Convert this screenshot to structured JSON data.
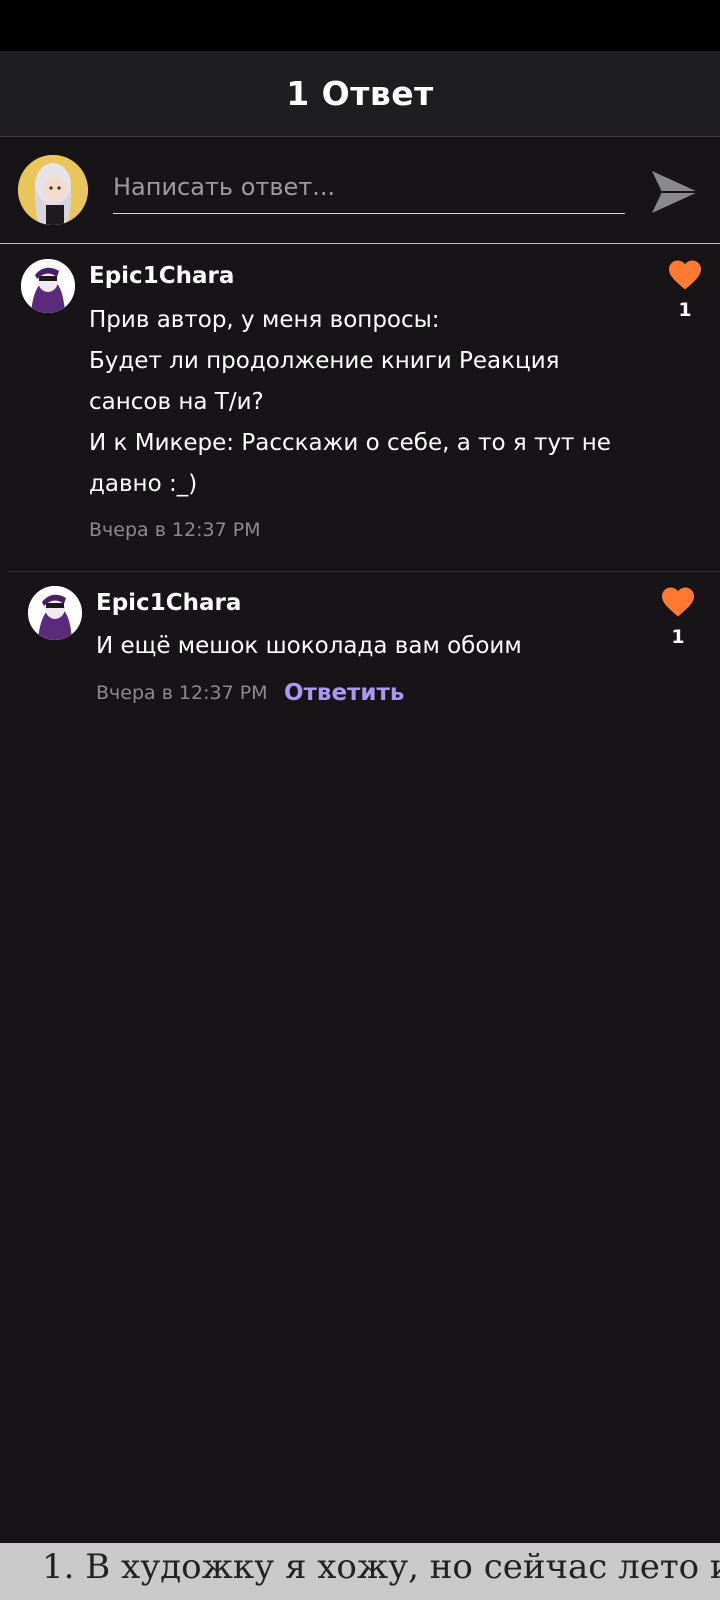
{
  "header": {
    "title": "1 Ответ"
  },
  "compose": {
    "placeholder": "Написать ответ..."
  },
  "comments": [
    {
      "author": "Epic1Chara",
      "text": "Прив автор, у меня вопросы:\nБудет ли продолжение книги Реакция\nсансов на Т/и?\nИ к Микере: Расскажи о себе, а то я тут не\nдавно :_)",
      "time": "Вчера в 12:37 PM",
      "likes": "1"
    },
    {
      "author": "Epic1Chara",
      "text": "И ещё мешок шоколада вам обоим",
      "time": "Вчера в 12:37 PM",
      "reply_label": "Ответить",
      "likes": "1"
    }
  ],
  "background_page": {
    "peek_text": "1. В художку я хожу, но сейчас лето и"
  },
  "colors": {
    "background": "#161416",
    "header": "#1e1d1f",
    "accent_like": "#ff7a30",
    "reply_link": "#a79af0",
    "muted_text": "#8b8b8e"
  }
}
